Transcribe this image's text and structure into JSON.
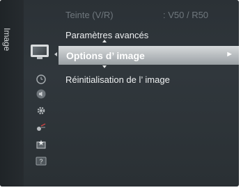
{
  "sidebar": {
    "label": "Image"
  },
  "menu": {
    "top_item": {
      "label": "Teinte (V/R)",
      "value": ": V50 / R50"
    },
    "items": [
      {
        "label": "Paramètres avancés"
      },
      {
        "label": "Options d’ image",
        "selected": true
      },
      {
        "label": "Réinitialisation de l’ image"
      }
    ],
    "submenu_arrow": "►"
  },
  "icons": [
    "tv-picture-icon",
    "clock-icon",
    "sound-icon",
    "gear-icon",
    "input-icon",
    "app-icon",
    "support-icon"
  ],
  "colors": {
    "panel": "#2b3136",
    "highlight": "#c7cbce",
    "text": "#eef0f1",
    "dim_text": "#6f777d"
  }
}
